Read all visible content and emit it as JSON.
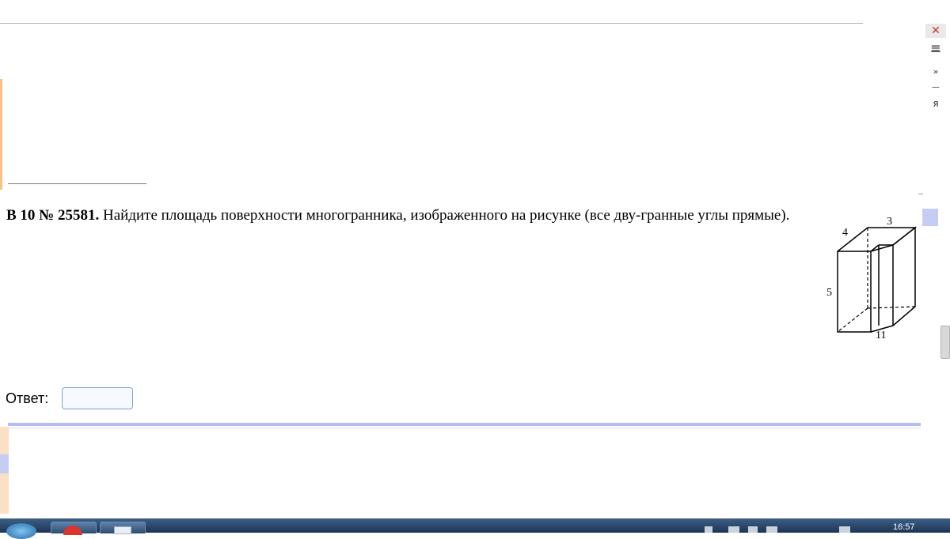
{
  "problem": {
    "number": "B 10 № 25581.",
    "text": " Найдите площадь поверхности многогранника, изображенного на рисунке (все дву-гранные углы прямые)."
  },
  "figure": {
    "label_top": "3",
    "label_left_top": "4",
    "label_height": "5",
    "label_bottom": "11"
  },
  "answer": {
    "label": "Ответ:",
    "value": "",
    "placeholder": ""
  },
  "right_rail": {
    "close": "✕",
    "menu": "≡",
    "minus": "—",
    "chevron": "»",
    "mark": "—",
    "ya": "я"
  },
  "taskbar": {
    "clock": "16:57"
  }
}
